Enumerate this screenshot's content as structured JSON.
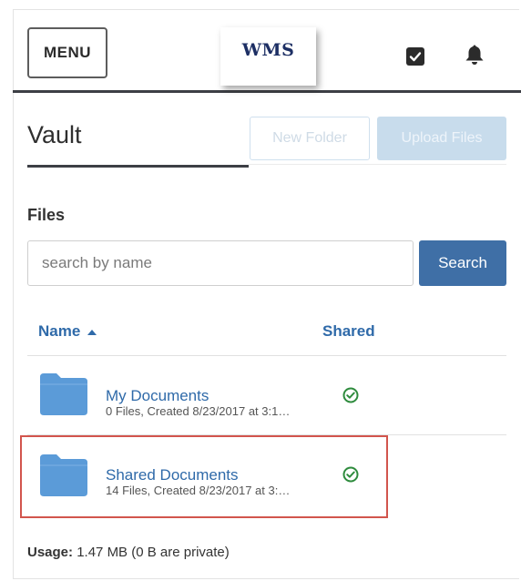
{
  "header": {
    "menu_label": "MENU",
    "logo_text": "WMS",
    "icons": [
      "checkbox-icon",
      "bell-icon"
    ]
  },
  "vault": {
    "title": "Vault",
    "new_folder_label": "New Folder",
    "upload_files_label": "Upload Files"
  },
  "files": {
    "section_label": "Files",
    "search_placeholder": "search by name",
    "search_button_label": "Search",
    "columns": {
      "name": "Name",
      "shared": "Shared"
    },
    "rows": [
      {
        "name": "My Documents",
        "meta": "0 Files, Created 8/23/2017 at 3:1…",
        "shared": true
      },
      {
        "name": "Shared Documents",
        "meta": "14 Files, Created 8/23/2017 at 3:…",
        "shared": true
      }
    ]
  },
  "usage": {
    "label": "Usage:",
    "value": "1.47 MB (0 B are private)"
  },
  "colors": {
    "accent": "#3f6fa6",
    "link": "#2f6aa9",
    "folder": "#5b9bd8",
    "shared_check": "#2e8b3d",
    "highlight": "#d2554d"
  }
}
